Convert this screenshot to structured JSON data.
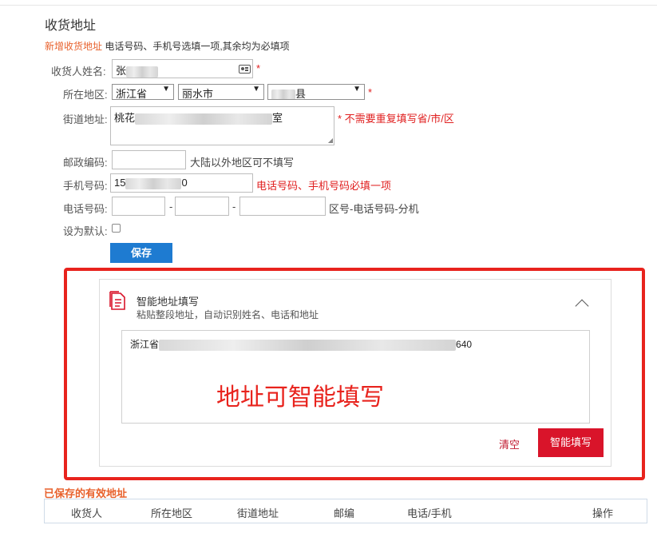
{
  "form": {
    "title": "收货地址",
    "hint_orange": "新增收货地址",
    "hint_rest": " 电话号码、手机号选填一项,其余均为必填项",
    "required_mark": "*",
    "name_label": "收货人姓名:",
    "name_value": "张",
    "region_label": "所在地区:",
    "province": "浙江省",
    "city": "丽水市",
    "county": "县",
    "street_label": "街道地址:",
    "street_prefix": "桃花",
    "street_suffix": "室",
    "street_note": "* 不需要重复填写省/市/区",
    "zip_label": "邮政编码:",
    "zip_note": "大陆以外地区可不填写",
    "mobile_label": "手机号码:",
    "mobile_prefix": "15",
    "mobile_suffix": "0",
    "mobile_note": "电话号码、手机号码必填一项",
    "phone_label": "电话号码:",
    "phone_dash": "-",
    "phone_note": "区号-电话号码-分机",
    "default_label": "设为默认:",
    "save_label": "保存"
  },
  "smart_fill": {
    "title": "智能地址填写",
    "subtitle": "粘贴整段地址，自动识别姓名、电话和地址",
    "content_prefix": "浙江省",
    "content_suffix": "640",
    "caption": "地址可智能填写",
    "clear_label": "清空",
    "fill_label": "智能填写"
  },
  "saved": {
    "title": "已保存的有效地址",
    "columns": [
      "收货人",
      "所在地区",
      "街道地址",
      "邮编",
      "电话/手机",
      "操作"
    ]
  },
  "colors": {
    "accent_blue": "#1e7bd1",
    "brand_red": "#d9142a",
    "orange": "#e8612c",
    "annotation_red": "#e8231d"
  }
}
